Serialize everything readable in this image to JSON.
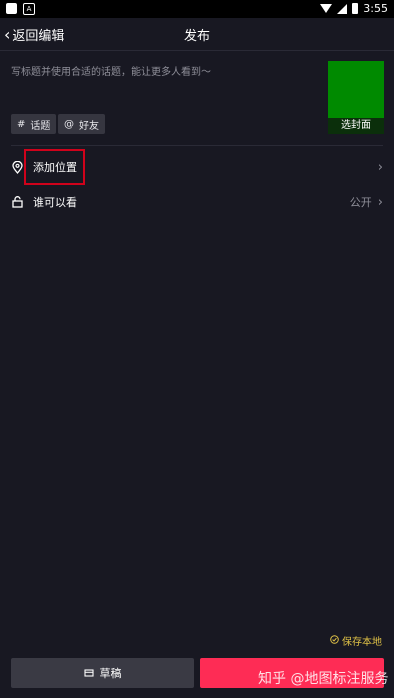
{
  "status_bar": {
    "time": "3:55",
    "notification_icon_letter": "A"
  },
  "nav": {
    "back_label": "返回编辑",
    "title": "发布"
  },
  "caption": {
    "placeholder": "写标题并使用合适的话题，能让更多人看到～"
  },
  "cover": {
    "label": "选封面",
    "color": "#008a00"
  },
  "chips": {
    "topic": "话题",
    "friend": "好友"
  },
  "rows": {
    "location": {
      "label": "添加位置"
    },
    "privacy": {
      "label": "谁可以看",
      "value": "公开"
    }
  },
  "footer": {
    "save_local": "保存本地",
    "draft_label": "草稿"
  },
  "watermark": "知乎 @地图标注服务",
  "colors": {
    "background": "#181822",
    "accent": "#fe2c55",
    "highlight": "#d0021b",
    "save_local": "#e0c247"
  }
}
